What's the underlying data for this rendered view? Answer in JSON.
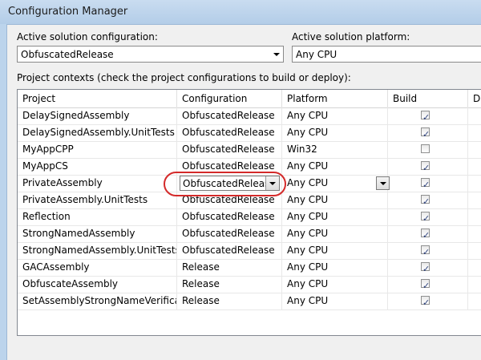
{
  "window": {
    "title": "Configuration Manager"
  },
  "solution_config": {
    "label": "Active solution configuration:",
    "value": "ObfuscatedRelease"
  },
  "solution_platform": {
    "label": "Active solution platform:",
    "value": "Any CPU"
  },
  "contexts_label": "Project contexts (check the project configurations to build or deploy):",
  "columns": [
    "Project",
    "Configuration",
    "Platform",
    "Build",
    "Dep"
  ],
  "rows": [
    {
      "project": "DelaySignedAssembly",
      "configuration": "ObfuscatedRelease",
      "platform": "Any CPU",
      "build": true
    },
    {
      "project": "DelaySignedAssembly.UnitTests",
      "configuration": "ObfuscatedRelease",
      "platform": "Any CPU",
      "build": true
    },
    {
      "project": "MyAppCPP",
      "configuration": "ObfuscatedRelease",
      "platform": "Win32",
      "build": false
    },
    {
      "project": "MyAppCS",
      "configuration": "ObfuscatedRelease",
      "platform": "Any CPU",
      "build": true
    },
    {
      "project": "PrivateAssembly",
      "configuration": "ObfuscatedRelease",
      "platform": "Any CPU",
      "build": true,
      "editing": true
    },
    {
      "project": "PrivateAssembly.UnitTests",
      "configuration": "ObfuscatedRelease",
      "platform": "Any CPU",
      "build": true
    },
    {
      "project": "Reflection",
      "configuration": "ObfuscatedRelease",
      "platform": "Any CPU",
      "build": true
    },
    {
      "project": "StrongNamedAssembly",
      "configuration": "ObfuscatedRelease",
      "platform": "Any CPU",
      "build": true
    },
    {
      "project": "StrongNamedAssembly.UnitTests",
      "configuration": "ObfuscatedRelease",
      "platform": "Any CPU",
      "build": true
    },
    {
      "project": "GACAssembly",
      "configuration": "Release",
      "platform": "Any CPU",
      "build": true
    },
    {
      "project": "ObfuscateAssembly",
      "configuration": "Release",
      "platform": "Any CPU",
      "build": true
    },
    {
      "project": "SetAssemblyStrongNameVerificat...",
      "configuration": "Release",
      "platform": "Any CPU",
      "build": true
    }
  ],
  "colors": {
    "highlight_ring": "#d42a2a",
    "frame": "#bcd4ec"
  }
}
